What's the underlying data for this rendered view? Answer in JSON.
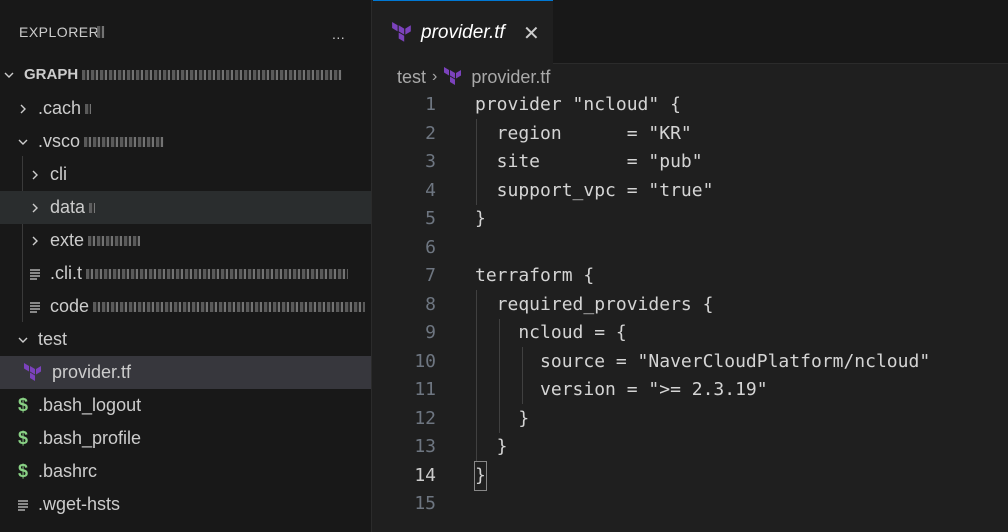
{
  "sidebar": {
    "title": "EXPLORER",
    "more_label": "...",
    "root_label": "GRAPH",
    "items": [
      {
        "label": ".cach",
        "type": "folder",
        "expanded": false
      },
      {
        "label": ".vsco",
        "type": "folder",
        "expanded": true
      },
      {
        "label": "cli",
        "type": "folder",
        "expanded": false
      },
      {
        "label": "data",
        "type": "folder",
        "expanded": false
      },
      {
        "label": "exte",
        "type": "folder",
        "expanded": false
      },
      {
        "label": ".cli.t",
        "type": "file"
      },
      {
        "label": "code",
        "type": "file"
      },
      {
        "label": "test",
        "type": "folder",
        "expanded": true
      },
      {
        "label": "provider.tf",
        "type": "terraform"
      },
      {
        "label": ".bash_logout",
        "type": "shell"
      },
      {
        "label": ".bash_profile",
        "type": "shell"
      },
      {
        "label": ".bashrc",
        "type": "shell"
      },
      {
        "label": ".wget-hsts",
        "type": "file"
      }
    ]
  },
  "tab": {
    "label": "provider.tf",
    "close_label": "✕"
  },
  "breadcrumb": {
    "folder": "test",
    "file": "provider.tf"
  },
  "code": {
    "active_line": 14,
    "lines": [
      {
        "n": "1",
        "text": "provider \"ncloud\" {"
      },
      {
        "n": "2",
        "text": "  region      = \"KR\""
      },
      {
        "n": "3",
        "text": "  site        = \"pub\""
      },
      {
        "n": "4",
        "text": "  support_vpc = \"true\""
      },
      {
        "n": "5",
        "text": "}"
      },
      {
        "n": "6",
        "text": ""
      },
      {
        "n": "7",
        "text": "terraform {"
      },
      {
        "n": "8",
        "text": "  required_providers {"
      },
      {
        "n": "9",
        "text": "    ncloud = {"
      },
      {
        "n": "10",
        "text": "      source = \"NaverCloudPlatform/ncloud\""
      },
      {
        "n": "11",
        "text": "      version = \">= 2.3.19\""
      },
      {
        "n": "12",
        "text": "    }"
      },
      {
        "n": "13",
        "text": "  }"
      },
      {
        "n": "14",
        "text": "}"
      },
      {
        "n": "15",
        "text": ""
      }
    ]
  },
  "colors": {
    "terraform_purple": "#7b42bc",
    "shell_green": "#89d185",
    "accent": "#0078d4"
  }
}
